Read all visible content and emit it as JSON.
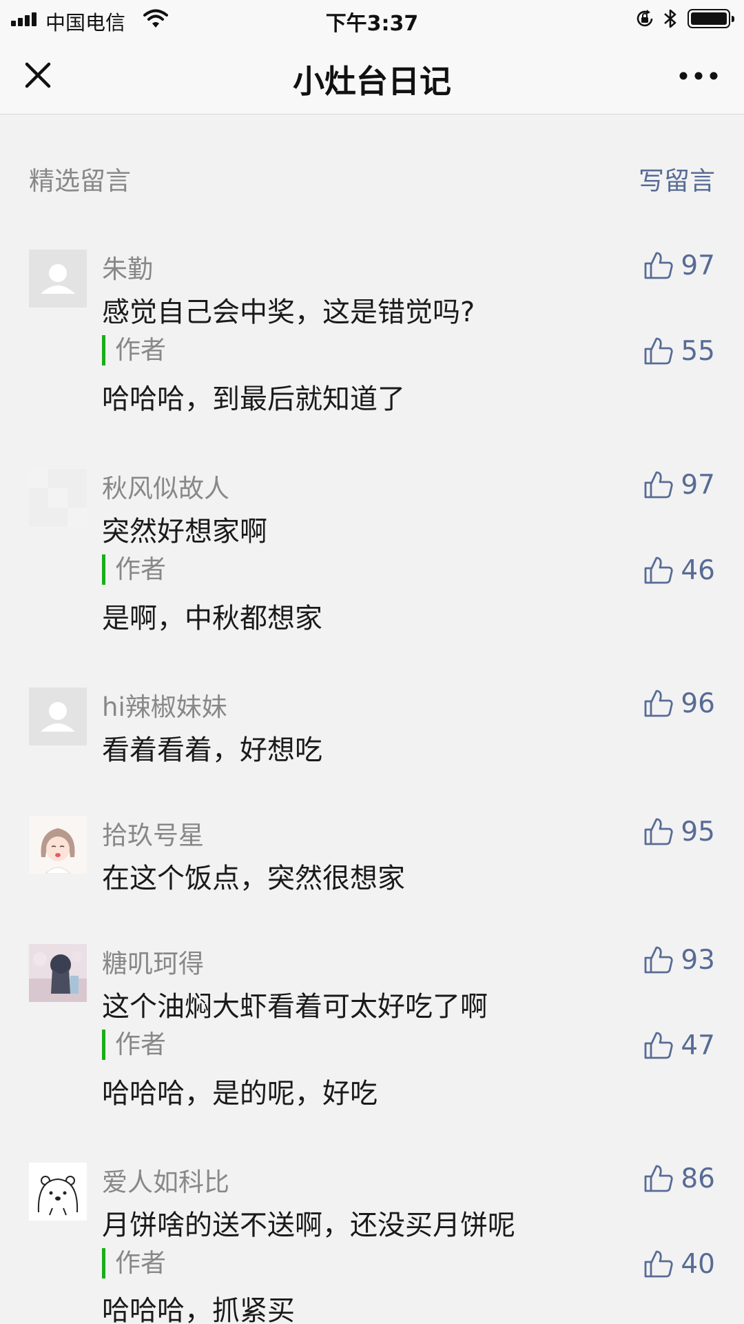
{
  "status_bar": {
    "carrier": "中国电信",
    "time": "下午3:37"
  },
  "nav": {
    "title": "小灶台日记"
  },
  "section": {
    "title": "精选留言",
    "write_label": "写留言"
  },
  "author_label": "作者",
  "comments": [
    {
      "nickname": "朱勤",
      "text": "感觉自己会中奖，这是错觉吗?",
      "likes": "97",
      "reply": {
        "text": "哈哈哈，到最后就知道了",
        "likes": "55"
      }
    },
    {
      "nickname": "秋风似故人",
      "text": "突然好想家啊",
      "likes": "97",
      "reply": {
        "text": "是啊，中秋都想家",
        "likes": "46"
      }
    },
    {
      "nickname": "hi辣椒妹妹",
      "text": "看着看着，好想吃",
      "likes": "96"
    },
    {
      "nickname": "拾玖号星",
      "text": "在这个饭点，突然很想家",
      "likes": "95"
    },
    {
      "nickname": "糖叽珂得",
      "text": "这个油焖大虾看着可太好吃了啊",
      "likes": "93",
      "reply": {
        "text": "哈哈哈，是的呢，好吃",
        "likes": "47"
      }
    },
    {
      "nickname": "爱人如科比",
      "text": "月饼啥的送不送啊，还没买月饼呢",
      "likes": "86",
      "reply": {
        "text": "哈哈哈，抓紧买",
        "likes": "40"
      }
    }
  ],
  "colors": {
    "link_blue": "#576b95",
    "author_bar_green": "#1aad19",
    "meta_gray": "#888888",
    "background": "#f2f2f2"
  }
}
